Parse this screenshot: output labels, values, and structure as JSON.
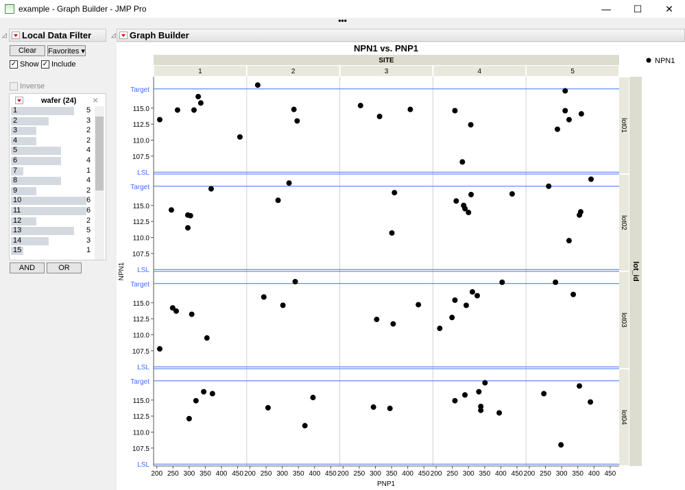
{
  "window": {
    "title": "example - Graph Builder - JMP Pro",
    "minimize": "—",
    "maximize": "☐",
    "close": "✕",
    "more": "•••"
  },
  "filter": {
    "header": "Local Data Filter",
    "clear": "Clear",
    "favorites": "Favorites ▾",
    "show": "Show",
    "include": "Include",
    "inverse": "Inverse",
    "column_title": "wafer (24)",
    "close": "×",
    "and": "AND",
    "or": "OR",
    "items": [
      {
        "label": "1",
        "count": 5
      },
      {
        "label": "2",
        "count": 3
      },
      {
        "label": "3",
        "count": 2
      },
      {
        "label": "4",
        "count": 2
      },
      {
        "label": "5",
        "count": 4
      },
      {
        "label": "6",
        "count": 4
      },
      {
        "label": "7",
        "count": 1
      },
      {
        "label": "8",
        "count": 4
      },
      {
        "label": "9",
        "count": 2
      },
      {
        "label": "10",
        "count": 6
      },
      {
        "label": "11",
        "count": 6
      },
      {
        "label": "12",
        "count": 2
      },
      {
        "label": "13",
        "count": 5
      },
      {
        "label": "14",
        "count": 3
      },
      {
        "label": "15",
        "count": 1
      }
    ]
  },
  "graph": {
    "header": "Graph Builder"
  },
  "chart_data": {
    "type": "scatter",
    "title": "NPN1 vs. PNP1",
    "xlabel": "PNP1",
    "ylabel": "NPN1",
    "column_group": "SITE",
    "columns": [
      "1",
      "2",
      "3",
      "4",
      "5"
    ],
    "row_group": "lot_id",
    "rows": [
      "lot01",
      "lot02",
      "lot03",
      "lot04"
    ],
    "legend": {
      "label": "NPN1",
      "placement": "top-right"
    },
    "xlim": [
      190,
      478
    ],
    "xticks": [
      200,
      250,
      300,
      350,
      400,
      450
    ],
    "ylim": [
      104.7,
      119.9
    ],
    "yticks": [
      107.5,
      110.0,
      112.5,
      115.0
    ],
    "reference_lines": [
      {
        "label": "Target",
        "value": 118
      },
      {
        "label": "LSL",
        "value": 105
      }
    ],
    "points": [
      {
        "row": 0,
        "col": 0,
        "x": 209,
        "y": 113.2
      },
      {
        "row": 0,
        "col": 0,
        "x": 264,
        "y": 114.7
      },
      {
        "row": 0,
        "col": 0,
        "x": 328,
        "y": 116.8
      },
      {
        "row": 0,
        "col": 0,
        "x": 315,
        "y": 114.7
      },
      {
        "row": 0,
        "col": 0,
        "x": 336,
        "y": 115.8
      },
      {
        "row": 0,
        "col": 0,
        "x": 457,
        "y": 110.5
      },
      {
        "row": 0,
        "col": 1,
        "x": 224,
        "y": 118.6
      },
      {
        "row": 0,
        "col": 1,
        "x": 336,
        "y": 114.8
      },
      {
        "row": 0,
        "col": 1,
        "x": 346,
        "y": 113.0
      },
      {
        "row": 0,
        "col": 2,
        "x": 254,
        "y": 115.4
      },
      {
        "row": 0,
        "col": 2,
        "x": 313,
        "y": 113.7
      },
      {
        "row": 0,
        "col": 2,
        "x": 408,
        "y": 114.8
      },
      {
        "row": 0,
        "col": 3,
        "x": 258,
        "y": 114.6
      },
      {
        "row": 0,
        "col": 3,
        "x": 307,
        "y": 112.4
      },
      {
        "row": 0,
        "col": 3,
        "x": 281,
        "y": 106.6
      },
      {
        "row": 0,
        "col": 4,
        "x": 311,
        "y": 117.7
      },
      {
        "row": 0,
        "col": 4,
        "x": 311,
        "y": 114.6
      },
      {
        "row": 0,
        "col": 4,
        "x": 323,
        "y": 113.2
      },
      {
        "row": 0,
        "col": 4,
        "x": 361,
        "y": 114.1
      },
      {
        "row": 0,
        "col": 4,
        "x": 287,
        "y": 111.7
      },
      {
        "row": 1,
        "col": 0,
        "x": 245,
        "y": 114.3
      },
      {
        "row": 1,
        "col": 0,
        "x": 368,
        "y": 117.6
      },
      {
        "row": 1,
        "col": 0,
        "x": 296,
        "y": 113.5
      },
      {
        "row": 1,
        "col": 0,
        "x": 304,
        "y": 113.4
      },
      {
        "row": 1,
        "col": 0,
        "x": 296,
        "y": 111.5
      },
      {
        "row": 1,
        "col": 1,
        "x": 321,
        "y": 118.5
      },
      {
        "row": 1,
        "col": 1,
        "x": 287,
        "y": 115.8
      },
      {
        "row": 1,
        "col": 2,
        "x": 359,
        "y": 117.0
      },
      {
        "row": 1,
        "col": 2,
        "x": 351,
        "y": 110.7
      },
      {
        "row": 1,
        "col": 3,
        "x": 262,
        "y": 115.7
      },
      {
        "row": 1,
        "col": 3,
        "x": 285,
        "y": 115.0
      },
      {
        "row": 1,
        "col": 3,
        "x": 289,
        "y": 114.5
      },
      {
        "row": 1,
        "col": 3,
        "x": 300,
        "y": 113.9
      },
      {
        "row": 1,
        "col": 3,
        "x": 308,
        "y": 116.7
      },
      {
        "row": 1,
        "col": 3,
        "x": 435,
        "y": 116.8
      },
      {
        "row": 1,
        "col": 4,
        "x": 260,
        "y": 118.0
      },
      {
        "row": 1,
        "col": 4,
        "x": 391,
        "y": 119.1
      },
      {
        "row": 1,
        "col": 4,
        "x": 359,
        "y": 114.0
      },
      {
        "row": 1,
        "col": 4,
        "x": 355,
        "y": 113.5
      },
      {
        "row": 1,
        "col": 4,
        "x": 323,
        "y": 109.5
      },
      {
        "row": 2,
        "col": 0,
        "x": 209,
        "y": 107.8
      },
      {
        "row": 2,
        "col": 0,
        "x": 249,
        "y": 114.2
      },
      {
        "row": 2,
        "col": 0,
        "x": 260,
        "y": 113.7
      },
      {
        "row": 2,
        "col": 0,
        "x": 308,
        "y": 113.2
      },
      {
        "row": 2,
        "col": 0,
        "x": 355,
        "y": 109.5
      },
      {
        "row": 2,
        "col": 1,
        "x": 340,
        "y": 118.3
      },
      {
        "row": 2,
        "col": 1,
        "x": 243,
        "y": 115.9
      },
      {
        "row": 2,
        "col": 1,
        "x": 302,
        "y": 114.6
      },
      {
        "row": 2,
        "col": 2,
        "x": 304,
        "y": 112.4
      },
      {
        "row": 2,
        "col": 2,
        "x": 355,
        "y": 111.7
      },
      {
        "row": 2,
        "col": 2,
        "x": 433,
        "y": 114.7
      },
      {
        "row": 2,
        "col": 3,
        "x": 211,
        "y": 111.0
      },
      {
        "row": 2,
        "col": 3,
        "x": 249,
        "y": 112.7
      },
      {
        "row": 2,
        "col": 3,
        "x": 258,
        "y": 115.4
      },
      {
        "row": 2,
        "col": 3,
        "x": 293,
        "y": 114.6
      },
      {
        "row": 2,
        "col": 3,
        "x": 312,
        "y": 116.7
      },
      {
        "row": 2,
        "col": 3,
        "x": 327,
        "y": 116.1
      },
      {
        "row": 2,
        "col": 3,
        "x": 404,
        "y": 118.2
      },
      {
        "row": 2,
        "col": 4,
        "x": 281,
        "y": 118.2
      },
      {
        "row": 2,
        "col": 4,
        "x": 336,
        "y": 116.3
      },
      {
        "row": 3,
        "col": 0,
        "x": 300,
        "y": 112.1
      },
      {
        "row": 3,
        "col": 0,
        "x": 321,
        "y": 114.9
      },
      {
        "row": 3,
        "col": 0,
        "x": 345,
        "y": 116.3
      },
      {
        "row": 3,
        "col": 0,
        "x": 372,
        "y": 116.0
      },
      {
        "row": 3,
        "col": 1,
        "x": 256,
        "y": 113.8
      },
      {
        "row": 3,
        "col": 1,
        "x": 370,
        "y": 111.0
      },
      {
        "row": 3,
        "col": 1,
        "x": 395,
        "y": 115.4
      },
      {
        "row": 3,
        "col": 2,
        "x": 294,
        "y": 113.9
      },
      {
        "row": 3,
        "col": 2,
        "x": 345,
        "y": 113.7
      },
      {
        "row": 3,
        "col": 3,
        "x": 258,
        "y": 114.9
      },
      {
        "row": 3,
        "col": 3,
        "x": 289,
        "y": 115.8
      },
      {
        "row": 3,
        "col": 3,
        "x": 332,
        "y": 116.3
      },
      {
        "row": 3,
        "col": 3,
        "x": 338,
        "y": 114.0
      },
      {
        "row": 3,
        "col": 3,
        "x": 338,
        "y": 113.4
      },
      {
        "row": 3,
        "col": 3,
        "x": 351,
        "y": 117.7
      },
      {
        "row": 3,
        "col": 3,
        "x": 395,
        "y": 113.0
      },
      {
        "row": 3,
        "col": 4,
        "x": 245,
        "y": 116.0
      },
      {
        "row": 3,
        "col": 4,
        "x": 355,
        "y": 117.2
      },
      {
        "row": 3,
        "col": 4,
        "x": 389,
        "y": 114.7
      },
      {
        "row": 3,
        "col": 4,
        "x": 298,
        "y": 108.0
      }
    ],
    "colors": {
      "reference": "#3b6ff5",
      "points": "#000000",
      "strip": "#dcdccf"
    }
  }
}
